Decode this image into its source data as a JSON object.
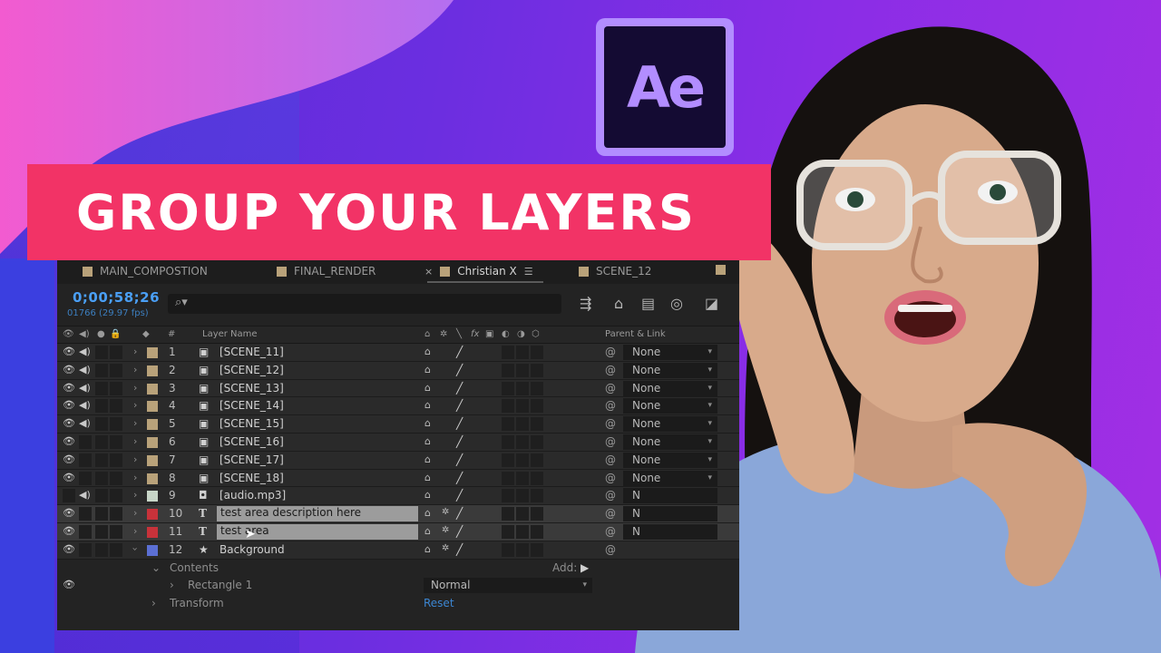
{
  "banner": {
    "headline": "GROUP YOUR LAYERS"
  },
  "logo": {
    "text": "Ae"
  },
  "colors": {
    "banner": "#f23366",
    "accent_blue": "#4a9ff5",
    "logo_purple": "#b28dff",
    "scene_label": "#b9a27a",
    "text_label": "#c8323a",
    "bg_label": "#5b6fd4"
  },
  "tabs": [
    {
      "label": "MAIN_COMPOSTION"
    },
    {
      "label": "FINAL_RENDER"
    },
    {
      "label": "Christian X",
      "close": "×",
      "menu": "☰"
    },
    {
      "label": "SCENE_12"
    }
  ],
  "toolbar": {
    "timecode": "0;00;58;26",
    "fps_info": "01766 (29.97 fps)",
    "search_icon": "⌕▾"
  },
  "columns": {
    "num": "#",
    "layer_name": "Layer Name",
    "fx": "fx",
    "parent": "Parent & Link"
  },
  "layers": [
    {
      "num": "1",
      "type": "▣",
      "name": "[SCENE_11]",
      "parent": "None",
      "audio": true,
      "label": "#b9a27a"
    },
    {
      "num": "2",
      "type": "▣",
      "name": "[SCENE_12]",
      "parent": "None",
      "audio": true,
      "label": "#b9a27a"
    },
    {
      "num": "3",
      "type": "▣",
      "name": "[SCENE_13]",
      "parent": "None",
      "audio": true,
      "label": "#b9a27a"
    },
    {
      "num": "4",
      "type": "▣",
      "name": "[SCENE_14]",
      "parent": "None",
      "audio": true,
      "label": "#b9a27a"
    },
    {
      "num": "5",
      "type": "▣",
      "name": "[SCENE_15]",
      "parent": "None",
      "audio": true,
      "label": "#b9a27a"
    },
    {
      "num": "6",
      "type": "▣",
      "name": "[SCENE_16]",
      "parent": "None",
      "audio": false,
      "label": "#b9a27a"
    },
    {
      "num": "7",
      "type": "▣",
      "name": "[SCENE_17]",
      "parent": "None",
      "audio": false,
      "label": "#b9a27a"
    },
    {
      "num": "8",
      "type": "▣",
      "name": "[SCENE_18]",
      "parent": "None",
      "audio": false,
      "label": "#b9a27a"
    },
    {
      "num": "9",
      "type": "◘",
      "name": "[audio.mp3]",
      "parent": "N",
      "audio": true,
      "label": "#c8d6c8"
    },
    {
      "num": "10",
      "type": "T",
      "name": "test area description here",
      "parent": "N",
      "audio": false,
      "label": "#c8323a"
    },
    {
      "num": "11",
      "type": "T",
      "name": "test area",
      "parent": "N",
      "audio": false,
      "label": "#c8323a"
    },
    {
      "num": "12",
      "type": "★",
      "name": "Background",
      "parent": "",
      "audio": false,
      "label": "#5b6fd4"
    }
  ],
  "properties": {
    "contents": "Contents",
    "add": "Add:",
    "rectangle": "Rectangle 1",
    "mode": "Normal",
    "transform": "Transform",
    "reset": "Reset"
  }
}
